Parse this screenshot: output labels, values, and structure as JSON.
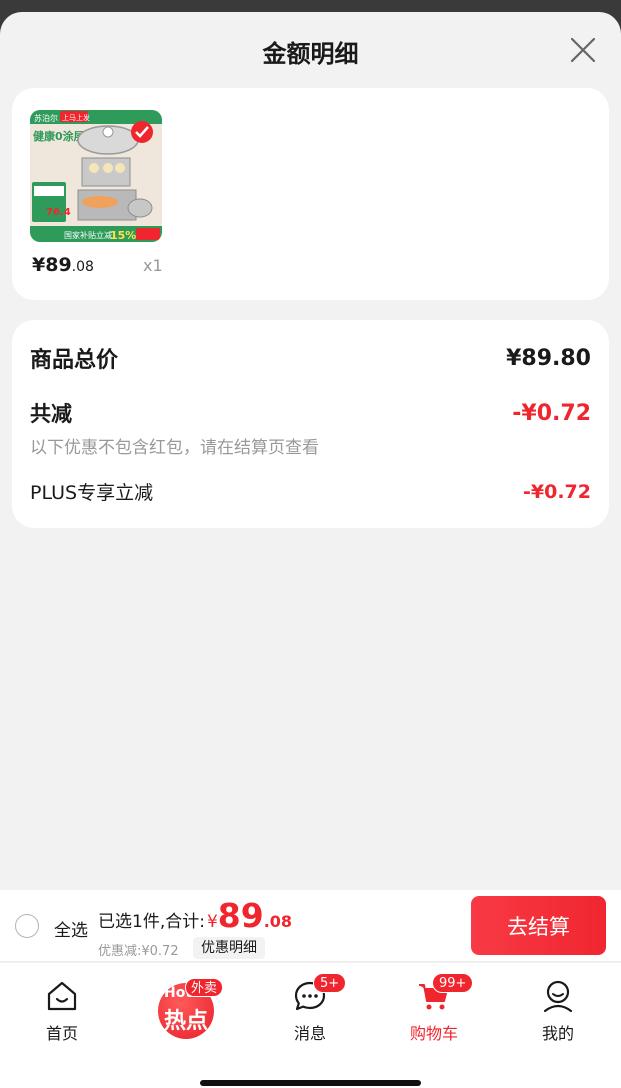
{
  "sheet": {
    "title": "金额明细"
  },
  "product": {
    "image": {
      "brand": "苏泊尔",
      "tag": "上马上发",
      "headline": "健康0涂层",
      "price_badge": "76.4",
      "subsidy_text": "国家补贴立减",
      "subsidy_pct": "15%"
    },
    "price_int": "¥89",
    "price_dec": ".08",
    "quantity": "x1"
  },
  "summary": {
    "total_label": "商品总价",
    "total_value": "¥89.80",
    "discount_label": "共减",
    "discount_value": "-¥0.72",
    "note": "以下优惠不包含红包，请在结算页查看",
    "plus_label": "PLUS专享立减",
    "plus_value": "-¥0.72"
  },
  "checkout": {
    "select_all": "全选",
    "selected_text": "已选1件,合计:",
    "currency": "¥",
    "amount_int": "89",
    "amount_dec": ".08",
    "saved_text": "优惠减:¥0.72",
    "detail_chip": "优惠明细",
    "checkout_button": "去结算"
  },
  "tabbar": {
    "home": "首页",
    "hot_small": "Hot",
    "hot_main": "热点",
    "hot_badge": "外卖",
    "messages": "消息",
    "messages_badge": "5+",
    "cart": "购物车",
    "cart_badge": "99+",
    "me": "我的"
  },
  "colors": {
    "accent": "#f0262f",
    "muted": "#999999",
    "background": "#f2f2f2"
  }
}
